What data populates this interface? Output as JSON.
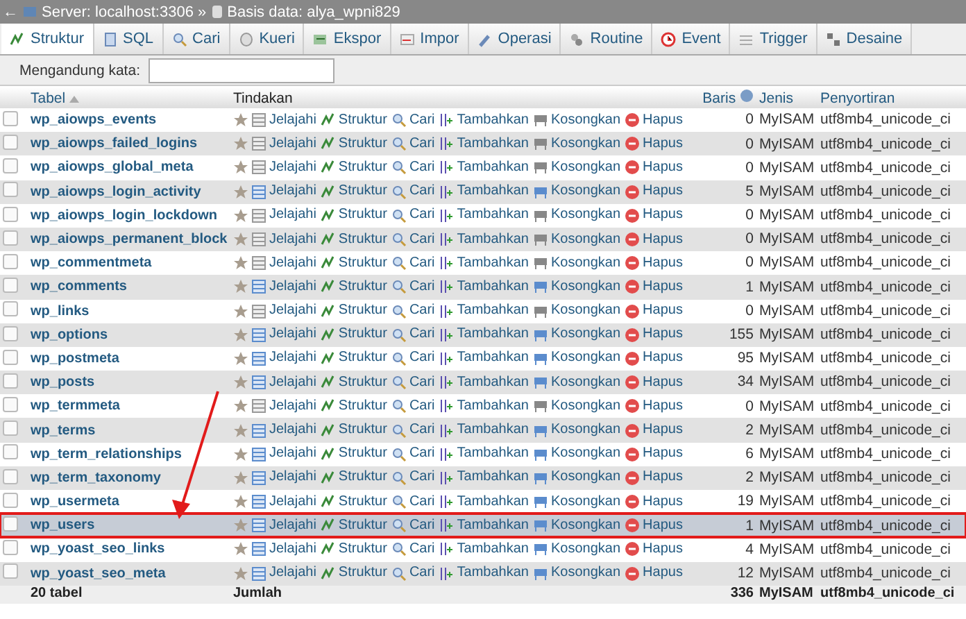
{
  "breadcrumb": {
    "back": "←",
    "server": "Server: localhost:3306 »",
    "database": "Basis data: alya_wpni829"
  },
  "tabs": [
    {
      "label": "Struktur",
      "selected": true
    },
    {
      "label": "SQL",
      "selected": false
    },
    {
      "label": "Cari",
      "selected": false
    },
    {
      "label": "Kueri",
      "selected": false
    },
    {
      "label": "Ekspor",
      "selected": false
    },
    {
      "label": "Impor",
      "selected": false
    },
    {
      "label": "Operasi",
      "selected": false
    },
    {
      "label": "Routine",
      "selected": false
    },
    {
      "label": "Event",
      "selected": false
    },
    {
      "label": "Trigger",
      "selected": false
    },
    {
      "label": "Desaine",
      "selected": false
    }
  ],
  "filter": {
    "label": "Mengandung kata:"
  },
  "table": {
    "columns": [
      "Tabel",
      "Tindakan",
      "Baris",
      "Jenis",
      "Penyortiran"
    ],
    "rows": [
      {
        "name": "wp_aiowps_events",
        "actions": [
          "Jelajahi",
          "Struktur",
          "Cari",
          "Tambahkan",
          "Kosongkan",
          "Hapus"
        ],
        "rows": "0",
        "engine": "MyISAM",
        "collation": "utf8mb4_unicode_ci",
        "empty": true,
        "selected": false
      },
      {
        "name": "wp_aiowps_failed_logins",
        "actions": [
          "Jelajahi",
          "Struktur",
          "Cari",
          "Tambahkan",
          "Kosongkan",
          "Hapus"
        ],
        "rows": "0",
        "engine": "MyISAM",
        "collation": "utf8mb4_unicode_ci",
        "empty": true,
        "selected": false
      },
      {
        "name": "wp_aiowps_global_meta",
        "actions": [
          "Jelajahi",
          "Struktur",
          "Cari",
          "Tambahkan",
          "Kosongkan",
          "Hapus"
        ],
        "rows": "0",
        "engine": "MyISAM",
        "collation": "utf8mb4_unicode_ci",
        "empty": true,
        "selected": false
      },
      {
        "name": "wp_aiowps_login_activity",
        "actions": [
          "Jelajahi",
          "Struktur",
          "Cari",
          "Tambahkan",
          "Kosongkan",
          "Hapus"
        ],
        "rows": "5",
        "engine": "MyISAM",
        "collation": "utf8mb4_unicode_ci",
        "empty": false,
        "selected": false
      },
      {
        "name": "wp_aiowps_login_lockdown",
        "actions": [
          "Jelajahi",
          "Struktur",
          "Cari",
          "Tambahkan",
          "Kosongkan",
          "Hapus"
        ],
        "rows": "0",
        "engine": "MyISAM",
        "collation": "utf8mb4_unicode_ci",
        "empty": true,
        "selected": false
      },
      {
        "name": "wp_aiowps_permanent_block",
        "actions": [
          "Jelajahi",
          "Struktur",
          "Cari",
          "Tambahkan",
          "Kosongkan",
          "Hapus"
        ],
        "rows": "0",
        "engine": "MyISAM",
        "collation": "utf8mb4_unicode_ci",
        "empty": true,
        "selected": false
      },
      {
        "name": "wp_commentmeta",
        "actions": [
          "Jelajahi",
          "Struktur",
          "Cari",
          "Tambahkan",
          "Kosongkan",
          "Hapus"
        ],
        "rows": "0",
        "engine": "MyISAM",
        "collation": "utf8mb4_unicode_ci",
        "empty": true,
        "selected": false
      },
      {
        "name": "wp_comments",
        "actions": [
          "Jelajahi",
          "Struktur",
          "Cari",
          "Tambahkan",
          "Kosongkan",
          "Hapus"
        ],
        "rows": "1",
        "engine": "MyISAM",
        "collation": "utf8mb4_unicode_ci",
        "empty": false,
        "selected": false
      },
      {
        "name": "wp_links",
        "actions": [
          "Jelajahi",
          "Struktur",
          "Cari",
          "Tambahkan",
          "Kosongkan",
          "Hapus"
        ],
        "rows": "0",
        "engine": "MyISAM",
        "collation": "utf8mb4_unicode_ci",
        "empty": true,
        "selected": false
      },
      {
        "name": "wp_options",
        "actions": [
          "Jelajahi",
          "Struktur",
          "Cari",
          "Tambahkan",
          "Kosongkan",
          "Hapus"
        ],
        "rows": "155",
        "engine": "MyISAM",
        "collation": "utf8mb4_unicode_ci",
        "empty": false,
        "selected": false
      },
      {
        "name": "wp_postmeta",
        "actions": [
          "Jelajahi",
          "Struktur",
          "Cari",
          "Tambahkan",
          "Kosongkan",
          "Hapus"
        ],
        "rows": "95",
        "engine": "MyISAM",
        "collation": "utf8mb4_unicode_ci",
        "empty": false,
        "selected": false
      },
      {
        "name": "wp_posts",
        "actions": [
          "Jelajahi",
          "Struktur",
          "Cari",
          "Tambahkan",
          "Kosongkan",
          "Hapus"
        ],
        "rows": "34",
        "engine": "MyISAM",
        "collation": "utf8mb4_unicode_ci",
        "empty": false,
        "selected": false
      },
      {
        "name": "wp_termmeta",
        "actions": [
          "Jelajahi",
          "Struktur",
          "Cari",
          "Tambahkan",
          "Kosongkan",
          "Hapus"
        ],
        "rows": "0",
        "engine": "MyISAM",
        "collation": "utf8mb4_unicode_ci",
        "empty": true,
        "selected": false
      },
      {
        "name": "wp_terms",
        "actions": [
          "Jelajahi",
          "Struktur",
          "Cari",
          "Tambahkan",
          "Kosongkan",
          "Hapus"
        ],
        "rows": "2",
        "engine": "MyISAM",
        "collation": "utf8mb4_unicode_ci",
        "empty": false,
        "selected": false
      },
      {
        "name": "wp_term_relationships",
        "actions": [
          "Jelajahi",
          "Struktur",
          "Cari",
          "Tambahkan",
          "Kosongkan",
          "Hapus"
        ],
        "rows": "6",
        "engine": "MyISAM",
        "collation": "utf8mb4_unicode_ci",
        "empty": false,
        "selected": false
      },
      {
        "name": "wp_term_taxonomy",
        "actions": [
          "Jelajahi",
          "Struktur",
          "Cari",
          "Tambahkan",
          "Kosongkan",
          "Hapus"
        ],
        "rows": "2",
        "engine": "MyISAM",
        "collation": "utf8mb4_unicode_ci",
        "empty": false,
        "selected": false
      },
      {
        "name": "wp_usermeta",
        "actions": [
          "Jelajahi",
          "Struktur",
          "Cari",
          "Tambahkan",
          "Kosongkan",
          "Hapus"
        ],
        "rows": "19",
        "engine": "MyISAM",
        "collation": "utf8mb4_unicode_ci",
        "empty": false,
        "selected": false
      },
      {
        "name": "wp_users",
        "actions": [
          "Jelajahi",
          "Struktur",
          "Cari",
          "Tambahkan",
          "Kosongkan",
          "Hapus"
        ],
        "rows": "1",
        "engine": "MyISAM",
        "collation": "utf8mb4_unicode_ci",
        "empty": false,
        "selected": true
      },
      {
        "name": "wp_yoast_seo_links",
        "actions": [
          "Jelajahi",
          "Struktur",
          "Cari",
          "Tambahkan",
          "Kosongkan",
          "Hapus"
        ],
        "rows": "4",
        "engine": "MyISAM",
        "collation": "utf8mb4_unicode_ci",
        "empty": false,
        "selected": false
      },
      {
        "name": "wp_yoast_seo_meta",
        "actions": [
          "Jelajahi",
          "Struktur",
          "Cari",
          "Tambahkan",
          "Kosongkan",
          "Hapus"
        ],
        "rows": "12",
        "engine": "MyISAM",
        "collation": "utf8mb4_unicode_ci",
        "empty": false,
        "selected": false
      }
    ],
    "footer": {
      "count": "20 tabel",
      "label": "Jumlah",
      "rows": "336",
      "engine": "MyISAM",
      "collation": "utf8mb4_unicode_ci"
    }
  }
}
